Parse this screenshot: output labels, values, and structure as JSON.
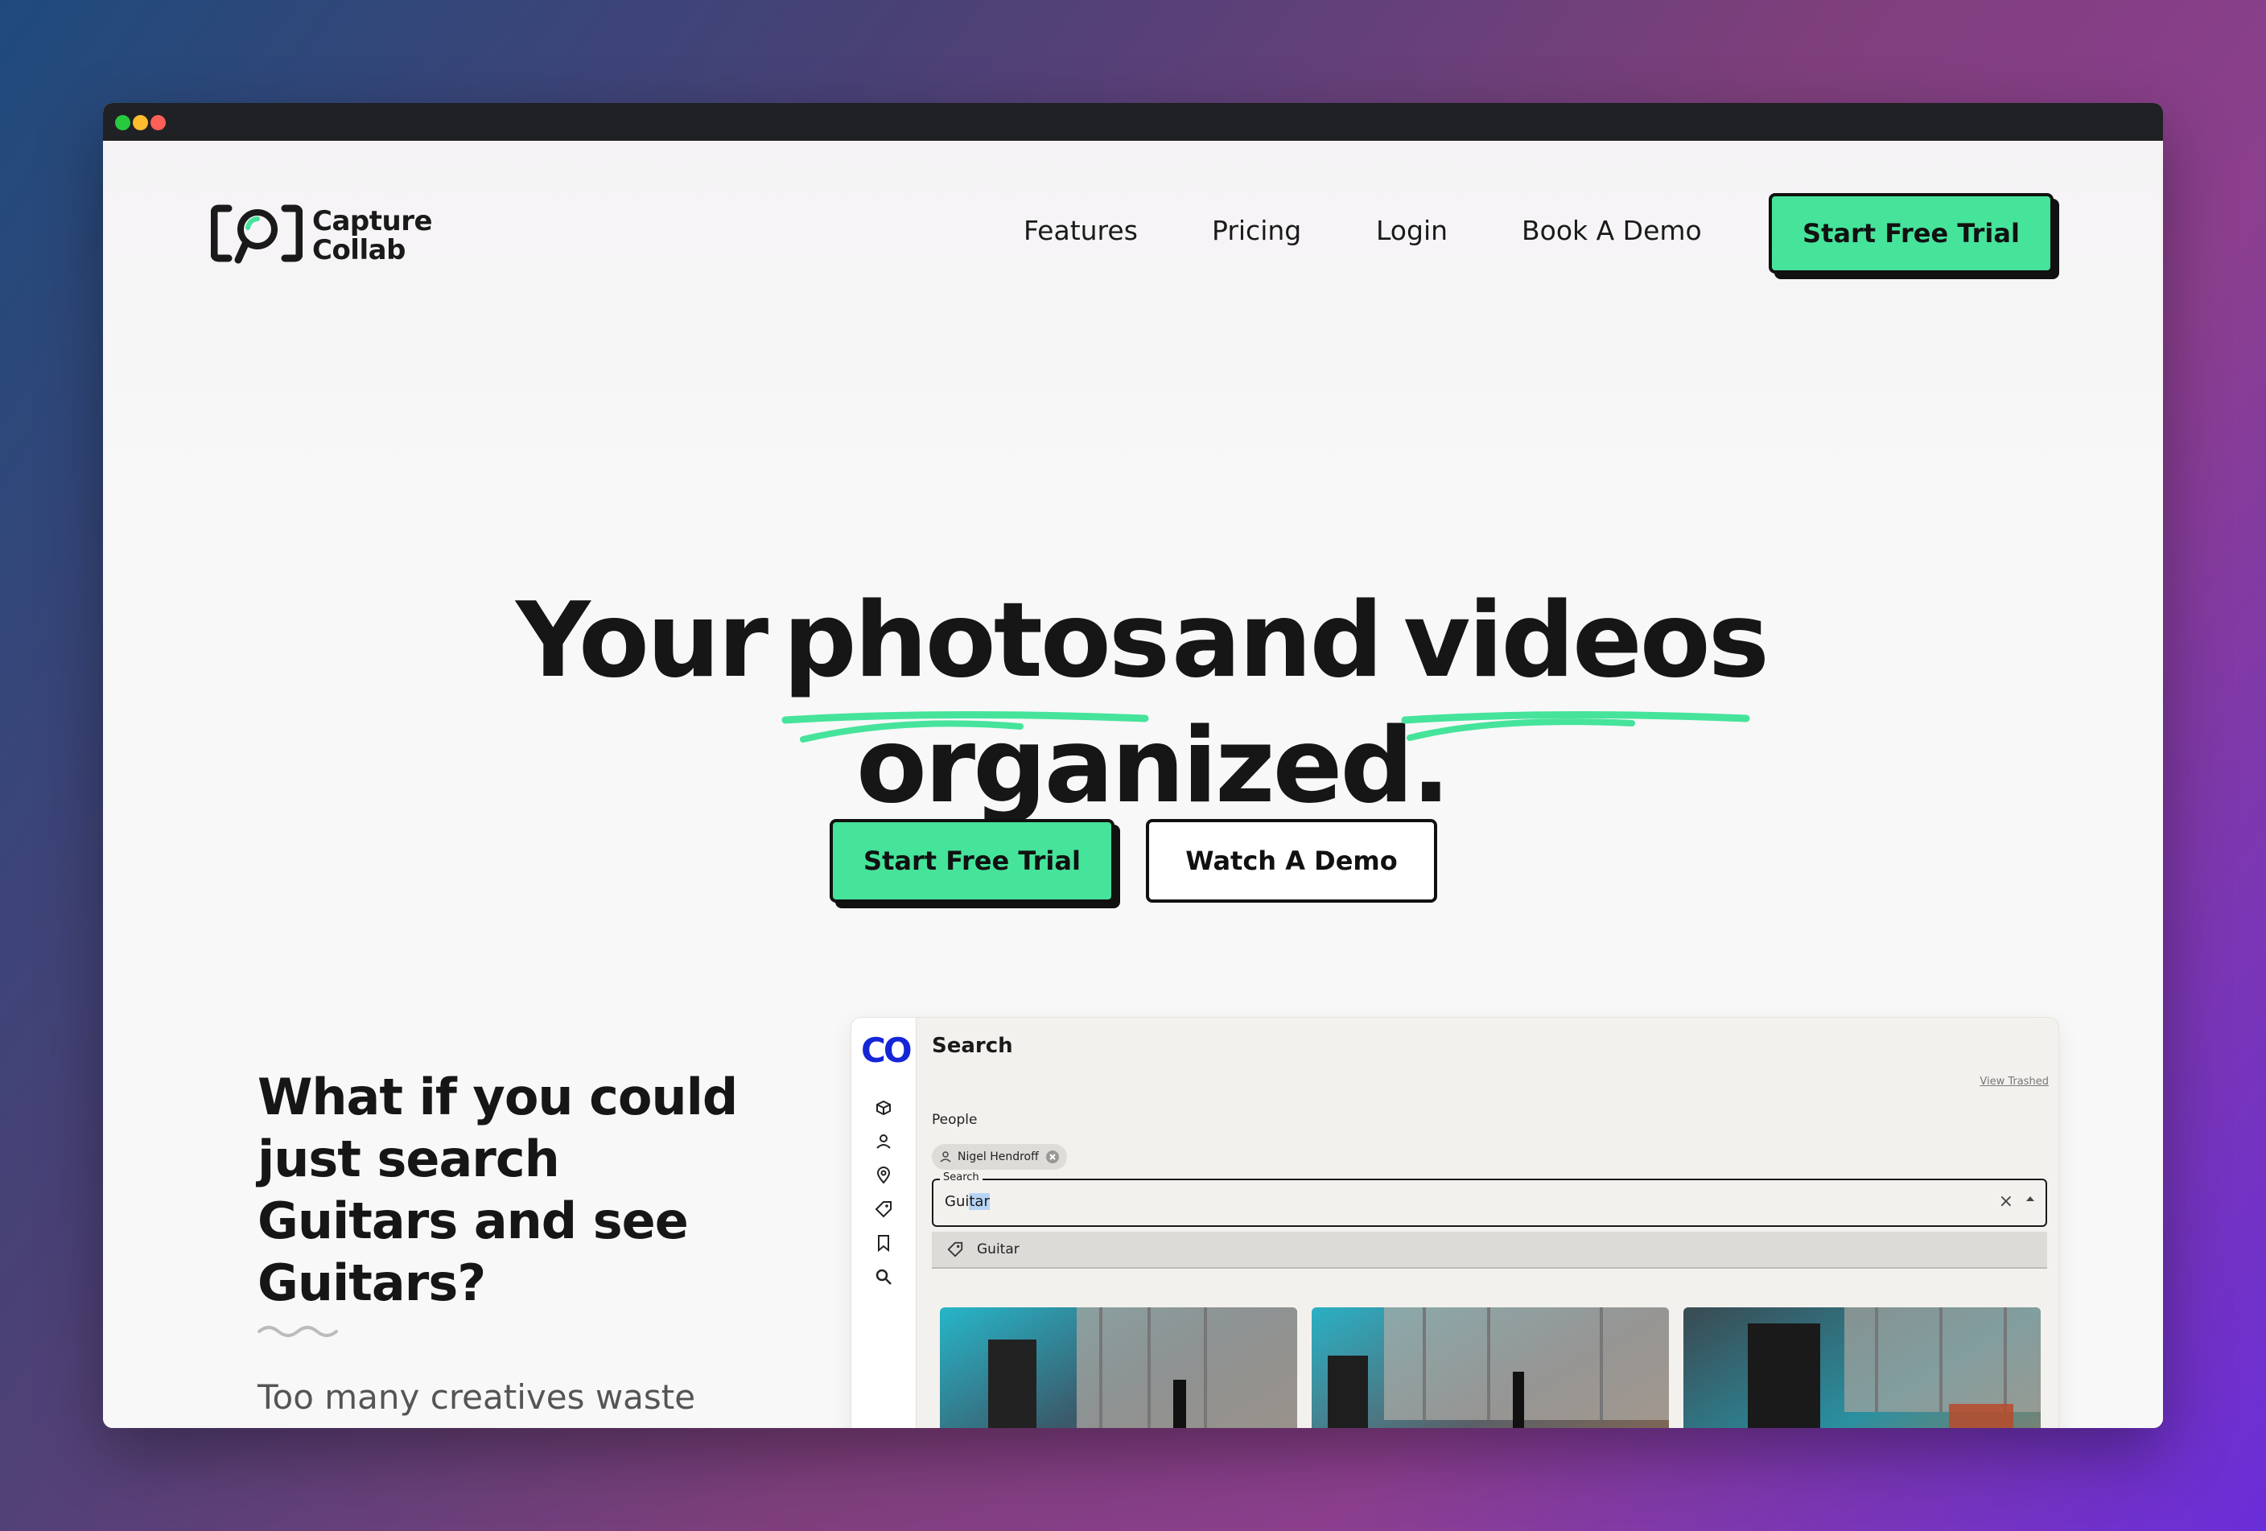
{
  "window": {
    "dots": [
      "#27c93f",
      "#ffbd2e",
      "#ff5f57"
    ]
  },
  "brand": {
    "line1": "Capture",
    "line2": "Collab",
    "accent": "#46e39b"
  },
  "nav": {
    "links": [
      "Features",
      "Pricing",
      "Login",
      "Book A Demo"
    ],
    "cta": "Start Free Trial"
  },
  "hero": {
    "word_your": "Your",
    "word_photos": "photos",
    "word_and": "and",
    "word_videos": "videos",
    "line2": "organized.",
    "primary_cta": "Start Free Trial",
    "secondary_cta": "Watch A Demo"
  },
  "feature": {
    "heading": "What if you could just search Guitars and see Guitars?",
    "body": "Too many creatives waste"
  },
  "app": {
    "logo": "CO",
    "title": "Search",
    "view_trashed": "View Trashed",
    "people_label": "People",
    "person_chip": "Nigel Hendroff",
    "search_legend": "Search",
    "search_value_plain": "Gui",
    "search_value_selected": "tar",
    "clear_glyph": "×",
    "suggestion": "Guitar",
    "sidebar_icons": [
      "box-icon",
      "person-icon",
      "location-pin-icon",
      "tag-icon",
      "bookmark-icon",
      "search-icon"
    ]
  }
}
